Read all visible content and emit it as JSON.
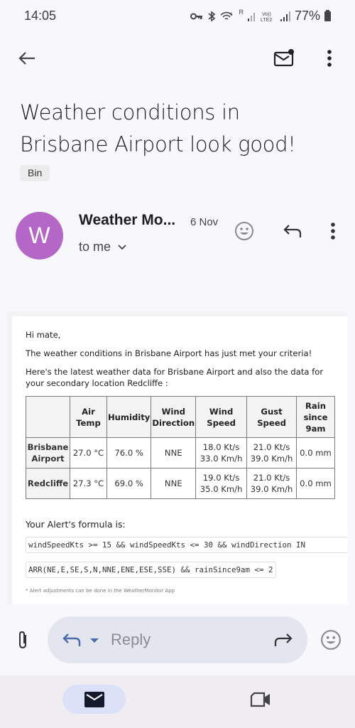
{
  "status_bar": {
    "time": "14:05",
    "icons": [
      "vpn-key-icon",
      "bluetooth-icon",
      "wifi-icon",
      "signal-icon",
      "volte-icon",
      "signal-icon-2"
    ],
    "network_label_1": "R",
    "network_label_2": "VoLTE2",
    "battery_percent": "77%"
  },
  "toolbar": {
    "back_icon": "arrow-left-icon",
    "mark_unread_icon": "mail-unread-icon",
    "more_icon": "more-vert-icon"
  },
  "email": {
    "subject": "Weather conditions in Brisbane Airport look good!",
    "label": "Bin",
    "avatar_letter": "W",
    "avatar_color": "#b467c6",
    "sender": "Weather Mo...",
    "date": "6 Nov",
    "recipient": "to me",
    "body": {
      "greeting": "Hi mate,",
      "line1": "The weather conditions in Brisbane Airport has just met your criteria!",
      "line2": "Here's the latest weather data for Brisbane Airport and also the data for your secondary location Redcliffe :",
      "table": {
        "headers": [
          "",
          "Air Temp",
          "Humidity",
          "Wind Direction",
          "Wind Speed",
          "Gust Speed",
          "Rain since 9am"
        ],
        "rows": [
          {
            "location": "Brisbane Airport",
            "air_temp": "27.0 °C",
            "humidity": "76.0 %",
            "wind_direction": "NNE",
            "wind_speed_kts": "18.0 Kt/s",
            "wind_speed_kmh": "33.0 Km/h",
            "gust_speed_kts": "21.0 Kt/s",
            "gust_speed_kmh": "39.0 Km/h",
            "rain": "0.0 mm"
          },
          {
            "location": "Redcliffe",
            "air_temp": "27.3 °C",
            "humidity": "69.0 %",
            "wind_direction": "NNE",
            "wind_speed_kts": "19.0 Kt/s",
            "wind_speed_kmh": "35.0 Km/h",
            "gust_speed_kts": "21.0 Kt/s",
            "gust_speed_kmh": "39.0 Km/h",
            "rain": "0.0 mm"
          }
        ]
      },
      "formula_label": "Your Alert's formula is:",
      "formula_line1": "windSpeedKts >= 15 && windSpeedKts <= 30 && windDirection IN",
      "formula_line2": "ARR(NE,E,SE,S,N,NNE,ENE,ESE,SSE) && rainSince9am <= 2",
      "footnote": "* Alert adjustments can be done in the WeatherMonitor App"
    }
  },
  "reply_bar": {
    "reply_placeholder": "Reply",
    "accent_color": "#4a6ba8"
  },
  "bottom_nav": {
    "items": [
      {
        "name": "mail",
        "active": true
      },
      {
        "name": "meet",
        "active": false
      }
    ]
  }
}
